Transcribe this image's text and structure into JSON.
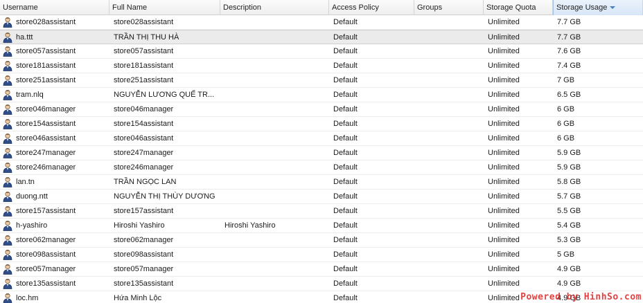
{
  "columns": [
    {
      "label": "Username"
    },
    {
      "label": "Full Name"
    },
    {
      "label": "Description"
    },
    {
      "label": "Access Policy"
    },
    {
      "label": "Groups"
    },
    {
      "label": "Storage Quota"
    },
    {
      "label": "Storage Usage",
      "sorted": "descending"
    }
  ],
  "rows": [
    {
      "username": "store028assistant",
      "full_name": "store028assistant",
      "description": "",
      "access_policy": "Default",
      "groups": "",
      "quota": "Unlimited",
      "usage": "7.7 GB"
    },
    {
      "username": "ha.ttt",
      "full_name": "TRẦN THỊ THU HÀ",
      "description": "",
      "access_policy": "Default",
      "groups": "",
      "quota": "Unlimited",
      "usage": "7.7 GB",
      "selected": true
    },
    {
      "username": "store057assistant",
      "full_name": "store057assistant",
      "description": "",
      "access_policy": "Default",
      "groups": "",
      "quota": "Unlimited",
      "usage": "7.6 GB"
    },
    {
      "username": "store181assistant",
      "full_name": "store181assistant",
      "description": "",
      "access_policy": "Default",
      "groups": "",
      "quota": "Unlimited",
      "usage": "7.4 GB"
    },
    {
      "username": "store251assistant",
      "full_name": "store251assistant",
      "description": "",
      "access_policy": "Default",
      "groups": "",
      "quota": "Unlimited",
      "usage": "7 GB"
    },
    {
      "username": "tram.nlq",
      "full_name": "NGUYỄN LƯƠNG QUẾ TR...",
      "description": "",
      "access_policy": "Default",
      "groups": "",
      "quota": "Unlimited",
      "usage": "6.5 GB"
    },
    {
      "username": "store046manager",
      "full_name": "store046manager",
      "description": "",
      "access_policy": "Default",
      "groups": "",
      "quota": "Unlimited",
      "usage": "6 GB"
    },
    {
      "username": "store154assistant",
      "full_name": "store154assistant",
      "description": "",
      "access_policy": "Default",
      "groups": "",
      "quota": "Unlimited",
      "usage": "6 GB"
    },
    {
      "username": "store046assistant",
      "full_name": "store046assistant",
      "description": "",
      "access_policy": "Default",
      "groups": "",
      "quota": "Unlimited",
      "usage": "6 GB"
    },
    {
      "username": "store247manager",
      "full_name": "store247manager",
      "description": "",
      "access_policy": "Default",
      "groups": "",
      "quota": "Unlimited",
      "usage": "5.9 GB"
    },
    {
      "username": "store246manager",
      "full_name": "store246manager",
      "description": "",
      "access_policy": "Default",
      "groups": "",
      "quota": "Unlimited",
      "usage": "5.9 GB"
    },
    {
      "username": "lan.tn",
      "full_name": "TRẦN NGỌC LAN",
      "description": "",
      "access_policy": "Default",
      "groups": "",
      "quota": "Unlimited",
      "usage": "5.8 GB"
    },
    {
      "username": "duong.ntt",
      "full_name": "NGUYỄN THỊ THÙY DƯƠNG",
      "description": "",
      "access_policy": "Default",
      "groups": "",
      "quota": "Unlimited",
      "usage": "5.7 GB"
    },
    {
      "username": "store157assistant",
      "full_name": "store157assistant",
      "description": "",
      "access_policy": "Default",
      "groups": "",
      "quota": "Unlimited",
      "usage": "5.5 GB"
    },
    {
      "username": "h-yashiro",
      "full_name": "Hiroshi Yashiro",
      "description": "Hiroshi Yashiro",
      "access_policy": "Default",
      "groups": "",
      "quota": "Unlimited",
      "usage": "5.4 GB"
    },
    {
      "username": "store062manager",
      "full_name": "store062manager",
      "description": "",
      "access_policy": "Default",
      "groups": "",
      "quota": "Unlimited",
      "usage": "5.3 GB"
    },
    {
      "username": "store098assistant",
      "full_name": "store098assistant",
      "description": "",
      "access_policy": "Default",
      "groups": "",
      "quota": "Unlimited",
      "usage": "5 GB"
    },
    {
      "username": "store057manager",
      "full_name": "store057manager",
      "description": "",
      "access_policy": "Default",
      "groups": "",
      "quota": "Unlimited",
      "usage": "4.9 GB"
    },
    {
      "username": "store135assistant",
      "full_name": "store135assistant",
      "description": "",
      "access_policy": "Default",
      "groups": "",
      "quota": "Unlimited",
      "usage": "4.9 GB"
    },
    {
      "username": "loc.hm",
      "full_name": "Hứa Minh Lộc",
      "description": "",
      "access_policy": "Default",
      "groups": "",
      "quota": "Unlimited",
      "usage": "4.9 GB"
    }
  ],
  "watermark": "Powered by HinhSo.com",
  "icons": {
    "user": "user-icon",
    "sort": "sort-descending-icon"
  },
  "colors": {
    "sort_accent": "#4a7fc0",
    "watermark": "#e02020"
  }
}
